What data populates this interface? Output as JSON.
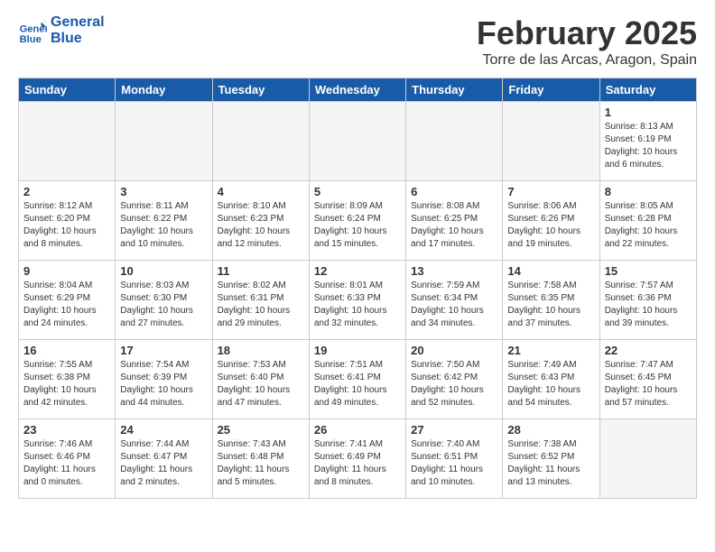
{
  "logo": {
    "line1": "General",
    "line2": "Blue"
  },
  "title": "February 2025",
  "location": "Torre de las Arcas, Aragon, Spain",
  "days_of_week": [
    "Sunday",
    "Monday",
    "Tuesday",
    "Wednesday",
    "Thursday",
    "Friday",
    "Saturday"
  ],
  "weeks": [
    [
      {
        "day": "",
        "info": ""
      },
      {
        "day": "",
        "info": ""
      },
      {
        "day": "",
        "info": ""
      },
      {
        "day": "",
        "info": ""
      },
      {
        "day": "",
        "info": ""
      },
      {
        "day": "",
        "info": ""
      },
      {
        "day": "1",
        "info": "Sunrise: 8:13 AM\nSunset: 6:19 PM\nDaylight: 10 hours\nand 6 minutes."
      }
    ],
    [
      {
        "day": "2",
        "info": "Sunrise: 8:12 AM\nSunset: 6:20 PM\nDaylight: 10 hours\nand 8 minutes."
      },
      {
        "day": "3",
        "info": "Sunrise: 8:11 AM\nSunset: 6:22 PM\nDaylight: 10 hours\nand 10 minutes."
      },
      {
        "day": "4",
        "info": "Sunrise: 8:10 AM\nSunset: 6:23 PM\nDaylight: 10 hours\nand 12 minutes."
      },
      {
        "day": "5",
        "info": "Sunrise: 8:09 AM\nSunset: 6:24 PM\nDaylight: 10 hours\nand 15 minutes."
      },
      {
        "day": "6",
        "info": "Sunrise: 8:08 AM\nSunset: 6:25 PM\nDaylight: 10 hours\nand 17 minutes."
      },
      {
        "day": "7",
        "info": "Sunrise: 8:06 AM\nSunset: 6:26 PM\nDaylight: 10 hours\nand 19 minutes."
      },
      {
        "day": "8",
        "info": "Sunrise: 8:05 AM\nSunset: 6:28 PM\nDaylight: 10 hours\nand 22 minutes."
      }
    ],
    [
      {
        "day": "9",
        "info": "Sunrise: 8:04 AM\nSunset: 6:29 PM\nDaylight: 10 hours\nand 24 minutes."
      },
      {
        "day": "10",
        "info": "Sunrise: 8:03 AM\nSunset: 6:30 PM\nDaylight: 10 hours\nand 27 minutes."
      },
      {
        "day": "11",
        "info": "Sunrise: 8:02 AM\nSunset: 6:31 PM\nDaylight: 10 hours\nand 29 minutes."
      },
      {
        "day": "12",
        "info": "Sunrise: 8:01 AM\nSunset: 6:33 PM\nDaylight: 10 hours\nand 32 minutes."
      },
      {
        "day": "13",
        "info": "Sunrise: 7:59 AM\nSunset: 6:34 PM\nDaylight: 10 hours\nand 34 minutes."
      },
      {
        "day": "14",
        "info": "Sunrise: 7:58 AM\nSunset: 6:35 PM\nDaylight: 10 hours\nand 37 minutes."
      },
      {
        "day": "15",
        "info": "Sunrise: 7:57 AM\nSunset: 6:36 PM\nDaylight: 10 hours\nand 39 minutes."
      }
    ],
    [
      {
        "day": "16",
        "info": "Sunrise: 7:55 AM\nSunset: 6:38 PM\nDaylight: 10 hours\nand 42 minutes."
      },
      {
        "day": "17",
        "info": "Sunrise: 7:54 AM\nSunset: 6:39 PM\nDaylight: 10 hours\nand 44 minutes."
      },
      {
        "day": "18",
        "info": "Sunrise: 7:53 AM\nSunset: 6:40 PM\nDaylight: 10 hours\nand 47 minutes."
      },
      {
        "day": "19",
        "info": "Sunrise: 7:51 AM\nSunset: 6:41 PM\nDaylight: 10 hours\nand 49 minutes."
      },
      {
        "day": "20",
        "info": "Sunrise: 7:50 AM\nSunset: 6:42 PM\nDaylight: 10 hours\nand 52 minutes."
      },
      {
        "day": "21",
        "info": "Sunrise: 7:49 AM\nSunset: 6:43 PM\nDaylight: 10 hours\nand 54 minutes."
      },
      {
        "day": "22",
        "info": "Sunrise: 7:47 AM\nSunset: 6:45 PM\nDaylight: 10 hours\nand 57 minutes."
      }
    ],
    [
      {
        "day": "23",
        "info": "Sunrise: 7:46 AM\nSunset: 6:46 PM\nDaylight: 11 hours\nand 0 minutes."
      },
      {
        "day": "24",
        "info": "Sunrise: 7:44 AM\nSunset: 6:47 PM\nDaylight: 11 hours\nand 2 minutes."
      },
      {
        "day": "25",
        "info": "Sunrise: 7:43 AM\nSunset: 6:48 PM\nDaylight: 11 hours\nand 5 minutes."
      },
      {
        "day": "26",
        "info": "Sunrise: 7:41 AM\nSunset: 6:49 PM\nDaylight: 11 hours\nand 8 minutes."
      },
      {
        "day": "27",
        "info": "Sunrise: 7:40 AM\nSunset: 6:51 PM\nDaylight: 11 hours\nand 10 minutes."
      },
      {
        "day": "28",
        "info": "Sunrise: 7:38 AM\nSunset: 6:52 PM\nDaylight: 11 hours\nand 13 minutes."
      },
      {
        "day": "",
        "info": ""
      }
    ]
  ]
}
